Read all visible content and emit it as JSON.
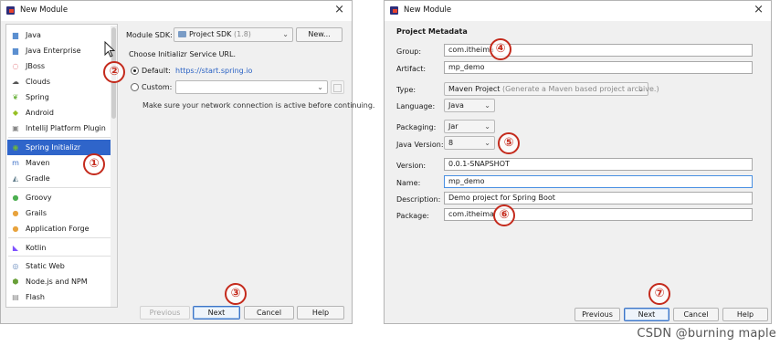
{
  "left_dialog": {
    "title": "New Module",
    "close_glyph": "×",
    "categories": [
      {
        "label": "Java",
        "icon": "folder-icon",
        "color": "#5b8fd0"
      },
      {
        "label": "Java Enterprise",
        "icon": "enterprise-icon",
        "color": "#5b8fd0"
      },
      {
        "label": "JBoss",
        "icon": "jboss-icon",
        "color": "#d4333b"
      },
      {
        "label": "Clouds",
        "icon": "cloud-icon",
        "color": "#555555"
      },
      {
        "label": "Spring",
        "icon": "spring-leaf-icon",
        "color": "#6db33f"
      },
      {
        "label": "Android",
        "icon": "android-icon",
        "color": "#97c024"
      },
      {
        "label": "IntelliJ Platform Plugin",
        "icon": "plugin-icon",
        "color": "#888888"
      },
      {
        "label": "Spring Initializr",
        "icon": "spring-initializr-icon",
        "color": "#6db33f",
        "selected": true
      },
      {
        "label": "Maven",
        "icon": "maven-icon",
        "color": "#3b6ec6"
      },
      {
        "label": "Gradle",
        "icon": "gradle-icon",
        "color": "#607d8b"
      },
      {
        "label": "Groovy",
        "icon": "groovy-icon",
        "color": "#4caf50"
      },
      {
        "label": "Grails",
        "icon": "grails-icon",
        "color": "#e8a33d"
      },
      {
        "label": "Application Forge",
        "icon": "forge-icon",
        "color": "#e8a33d"
      },
      {
        "label": "Kotlin",
        "icon": "kotlin-icon",
        "color": "#7f52ff"
      },
      {
        "label": "Static Web",
        "icon": "web-icon",
        "color": "#6c8ebf"
      },
      {
        "label": "Node.js and NPM",
        "icon": "nodejs-icon",
        "color": "#689f38"
      },
      {
        "label": "Flash",
        "icon": "flash-icon",
        "color": "#888888"
      }
    ],
    "sdk_label": "Module SDK:",
    "sdk_value": "Project SDK",
    "sdk_version": "(1.8)",
    "new_button": "New...",
    "service_url_heading": "Choose Initializr Service URL.",
    "default_label": "Default:",
    "default_url": "https://start.spring.io",
    "custom_label": "Custom:",
    "custom_value": "",
    "network_note": "Make sure your network connection is active before continuing.",
    "buttons": {
      "previous": "Previous",
      "next": "Next",
      "cancel": "Cancel",
      "help": "Help"
    }
  },
  "right_dialog": {
    "title": "New Module",
    "close_glyph": "×",
    "section_title": "Project Metadata",
    "group_label": "Group:",
    "group_value": "com.itheima",
    "artifact_label": "Artifact:",
    "artifact_value": "mp_demo",
    "type_label": "Type:",
    "type_value": "Maven Project",
    "type_hint": "(Generate a Maven based project archive.)",
    "language_label": "Language:",
    "language_value": "Java",
    "packaging_label": "Packaging:",
    "packaging_value": "Jar",
    "java_version_label": "Java Version:",
    "java_version_value": "8",
    "version_label": "Version:",
    "version_value": "0.0.1-SNAPSHOT",
    "name_label": "Name:",
    "name_value": "mp_demo",
    "description_label": "Description:",
    "description_value": "Demo project for Spring Boot",
    "package_label": "Package:",
    "package_value": "com.itheima",
    "buttons": {
      "previous": "Previous",
      "next": "Next",
      "cancel": "Cancel",
      "help": "Help"
    }
  },
  "steps": [
    "①",
    "②",
    "③",
    "④",
    "⑤",
    "⑥",
    "⑦"
  ],
  "watermark": "CSDN @burning maple",
  "colors": {
    "step_red": "#c42a1c",
    "selection_blue": "#2f65ca"
  }
}
